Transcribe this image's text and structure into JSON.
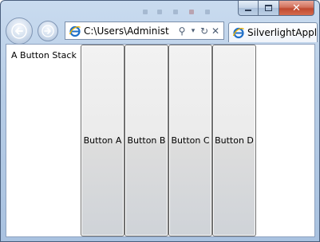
{
  "window": {
    "caption_buttons": {
      "minimize_icon": "minimize-icon",
      "maximize_icon": "maximize-icon",
      "close_icon": "close-icon",
      "close_glyph": "✕"
    }
  },
  "navigation": {
    "back_icon": "back-arrow-icon",
    "forward_icon": "forward-arrow-icon"
  },
  "address_bar": {
    "url": "C:\\Users\\Administ",
    "search_glyph": "⚲",
    "dropdown_glyph": "▾",
    "refresh_glyph": "↻",
    "stop_glyph": "✕"
  },
  "tab": {
    "title": "SilverlightAppl"
  },
  "content": {
    "stack_label": "A Button Stack",
    "buttons": [
      {
        "label": "Button A"
      },
      {
        "label": "Button B"
      },
      {
        "label": "Button C"
      },
      {
        "label": "Button D"
      }
    ]
  },
  "colors": {
    "chrome": "#b7cde6",
    "close_button": "#c04a30",
    "button_border": "#707070",
    "ie_blue": "#1e6fc8",
    "ie_gold": "#f0b400"
  }
}
